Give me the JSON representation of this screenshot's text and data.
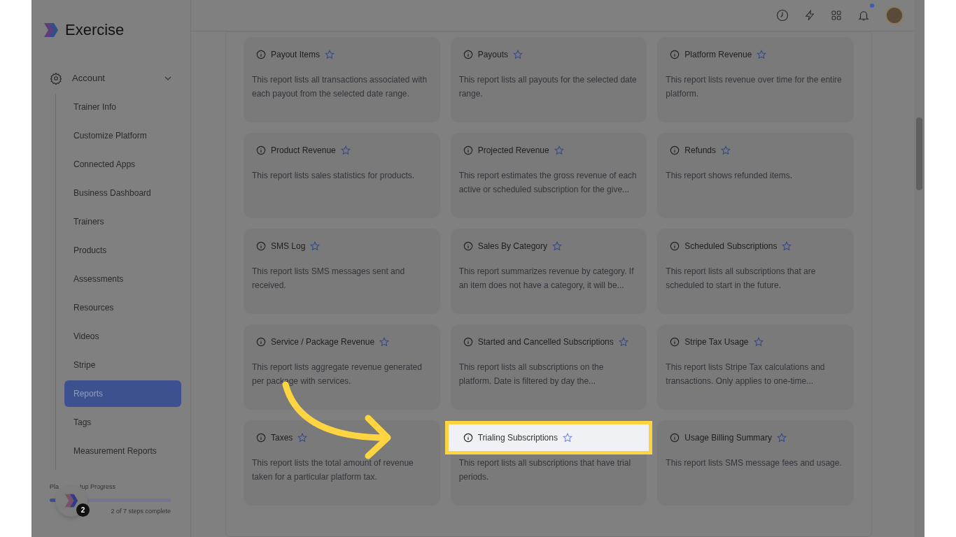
{
  "brand": {
    "name": "Exercise"
  },
  "sidebar": {
    "section": {
      "label": "Account",
      "expanded": true
    },
    "items": [
      {
        "label": "Trainer Info",
        "selected": false
      },
      {
        "label": "Customize Platform",
        "selected": false
      },
      {
        "label": "Connected Apps",
        "selected": false
      },
      {
        "label": "Business Dashboard",
        "selected": false
      },
      {
        "label": "Trainers",
        "selected": false
      },
      {
        "label": "Products",
        "selected": false
      },
      {
        "label": "Assessments",
        "selected": false
      },
      {
        "label": "Resources",
        "selected": false
      },
      {
        "label": "Videos",
        "selected": false
      },
      {
        "label": "Stripe",
        "selected": false
      },
      {
        "label": "Reports",
        "selected": true
      },
      {
        "label": "Tags",
        "selected": false
      },
      {
        "label": "Measurement Reports",
        "selected": false
      }
    ]
  },
  "setup_progress": {
    "label_start": "Pla",
    "label_end": "tup Progress",
    "level": 0.29,
    "caption": "2 of 7 steps complete",
    "badge": "2"
  },
  "header": {
    "notification_dot": true
  },
  "reports": [
    {
      "title": "Payout Items",
      "description": "This report lists all transactions associated with each payout from the selected date range.",
      "highlighted": false
    },
    {
      "title": "Payouts",
      "description": "This report lists all payouts for the selected date range.",
      "highlighted": false
    },
    {
      "title": "Platform Revenue",
      "description": "This report lists revenue over time for the entire platform.",
      "highlighted": false
    },
    {
      "title": "Product Revenue",
      "description": "This report lists sales statistics for products.",
      "highlighted": false
    },
    {
      "title": "Projected Revenue",
      "description": "This report estimates the gross revenue of each active or scheduled subscription for the give...",
      "highlighted": false
    },
    {
      "title": "Refunds",
      "description": "This report shows refunded items.",
      "highlighted": false
    },
    {
      "title": "SMS Log",
      "description": "This report lists SMS messages sent and received.",
      "highlighted": false
    },
    {
      "title": "Sales By Category",
      "description": "This report summarizes revenue by category. If an item does not have a category, it will be...",
      "highlighted": false
    },
    {
      "title": "Scheduled Subscriptions",
      "description": "This report lists all subscriptions that are scheduled to start in the future.",
      "highlighted": false
    },
    {
      "title": "Service / Package Revenue",
      "description": "This report lists aggregate revenue generated per package with services.",
      "highlighted": false
    },
    {
      "title": "Started and Cancelled Subscriptions",
      "description": "This report lists all subscriptions on the platform. Date is filtered by day the...",
      "highlighted": false
    },
    {
      "title": "Stripe Tax Usage",
      "description": "This report lists Stripe Tax calculations and transactions. Only applies to one-time...",
      "highlighted": false
    },
    {
      "title": "Taxes",
      "description": "This report lists the total amount of revenue taken for a particular platform tax.",
      "highlighted": false
    },
    {
      "title": "Trialing Subscriptions",
      "description": "This report lists all subscriptions that have trial periods.",
      "highlighted": true
    },
    {
      "title": "Usage Billing Summary",
      "description": "This report lists SMS message fees and usage.",
      "highlighted": false
    }
  ]
}
